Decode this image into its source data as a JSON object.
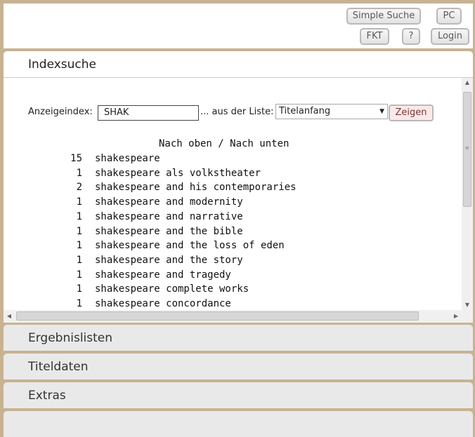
{
  "header": {
    "simple_search": "Simple Suche",
    "pc": "PC",
    "fkt": "FKT",
    "help": "?",
    "login": "Login"
  },
  "index_panel": {
    "title": "Indexsuche",
    "index_label": "Anzeigeindex:",
    "index_value": "SHAK",
    "list_label": "... aus der Liste:",
    "list_selected": "Titelanfang",
    "show_button": "Zeigen",
    "nav": "Nach oben / Nach unten",
    "entries": [
      {
        "count": "15",
        "term": "shakespeare"
      },
      {
        "count": "1",
        "term": "shakespeare als volkstheater"
      },
      {
        "count": "2",
        "term": "shakespeare and his contemporaries"
      },
      {
        "count": "1",
        "term": "shakespeare and modernity"
      },
      {
        "count": "1",
        "term": "shakespeare and narrative"
      },
      {
        "count": "1",
        "term": "shakespeare and the bible"
      },
      {
        "count": "1",
        "term": "shakespeare and the loss of eden"
      },
      {
        "count": "1",
        "term": "shakespeare and the story"
      },
      {
        "count": "1",
        "term": "shakespeare and tragedy"
      },
      {
        "count": "1",
        "term": "shakespeare complete works"
      },
      {
        "count": "1",
        "term": "shakespeare concordance"
      }
    ]
  },
  "accordion": {
    "results": "Ergebnislisten",
    "title_data": "Titeldaten",
    "extras": "Extras"
  },
  "colors": {
    "background": "#c7b393",
    "panel": "#ffffff",
    "accordion": "#e9e9e9"
  }
}
